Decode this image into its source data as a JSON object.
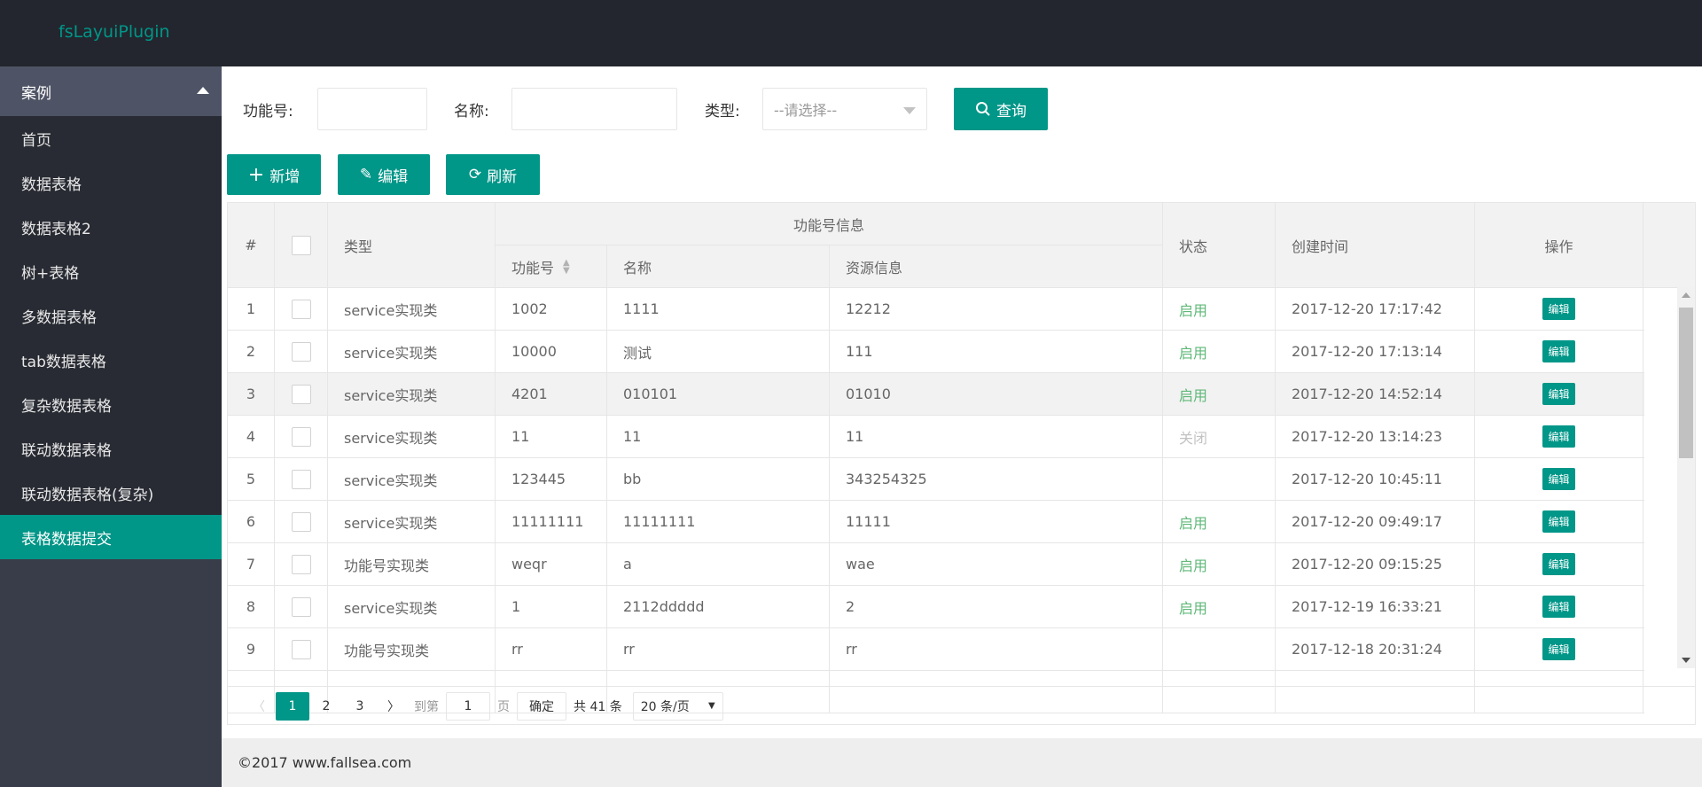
{
  "app": {
    "title": "fsLayuiPlugin"
  },
  "sidebar": {
    "group": "案例",
    "items": [
      "首页",
      "数据表格",
      "数据表格2",
      "树+表格",
      "多数据表格",
      "tab数据表格",
      "复杂数据表格",
      "联动数据表格",
      "联动数据表格(复杂)",
      "表格数据提交"
    ],
    "active_index": 9
  },
  "search": {
    "code_label": "功能号:",
    "code_value": "",
    "name_label": "名称:",
    "name_value": "",
    "type_label": "类型:",
    "type_placeholder": "--请选择--",
    "query_label": "查询"
  },
  "toolbar": {
    "add": "新增",
    "edit": "编辑",
    "refresh": "刷新"
  },
  "table": {
    "headers": {
      "index": "#",
      "type": "类型",
      "group": "功能号信息",
      "code": "功能号",
      "name": "名称",
      "resource": "资源信息",
      "status": "状态",
      "created": "创建时间",
      "action": "操作"
    },
    "rows": [
      {
        "i": "1",
        "type": "service实现类",
        "code": "1002",
        "name": "1111",
        "res": "12212",
        "status": "启用",
        "time": "2017-12-20 17:17:42"
      },
      {
        "i": "2",
        "type": "service实现类",
        "code": "10000",
        "name": "测试",
        "res": "111",
        "status": "启用",
        "time": "2017-12-20 17:13:14"
      },
      {
        "i": "3",
        "type": "service实现类",
        "code": "4201",
        "name": "010101",
        "res": "01010",
        "status": "启用",
        "time": "2017-12-20 14:52:14"
      },
      {
        "i": "4",
        "type": "service实现类",
        "code": "11",
        "name": "11",
        "res": "11",
        "status": "关闭",
        "time": "2017-12-20 13:14:23"
      },
      {
        "i": "5",
        "type": "service实现类",
        "code": "123445",
        "name": "bb",
        "res": "343254325",
        "status": "",
        "time": "2017-12-20 10:45:11"
      },
      {
        "i": "6",
        "type": "service实现类",
        "code": "11111111",
        "name": "11111111",
        "res": "11111",
        "status": "启用",
        "time": "2017-12-20 09:49:17"
      },
      {
        "i": "7",
        "type": "功能号实现类",
        "code": "weqr",
        "name": "a",
        "res": "wae",
        "status": "启用",
        "time": "2017-12-20 09:15:25"
      },
      {
        "i": "8",
        "type": "service实现类",
        "code": "1",
        "name": "2112ddddd",
        "res": "2",
        "status": "启用",
        "time": "2017-12-19 16:33:21"
      },
      {
        "i": "9",
        "type": "功能号实现类",
        "code": "rr",
        "name": "rr",
        "res": "rr",
        "status": "",
        "time": "2017-12-18 20:31:24"
      }
    ],
    "edit_label": "编辑"
  },
  "pager": {
    "pages": [
      "1",
      "2",
      "3"
    ],
    "current": "1",
    "goto": "到第",
    "goto_value": "1",
    "page_unit": "页",
    "confirm": "确定",
    "total": "共 41 条",
    "page_size": "20 条/页"
  },
  "footer": {
    "text": "©2017 www.fallsea.com"
  },
  "colors": {
    "accent": "#009688",
    "header_bg": "#23262e",
    "sidebar_bg": "#282b33",
    "status_on": "#5fb878",
    "status_off": "#c2c2c2"
  }
}
